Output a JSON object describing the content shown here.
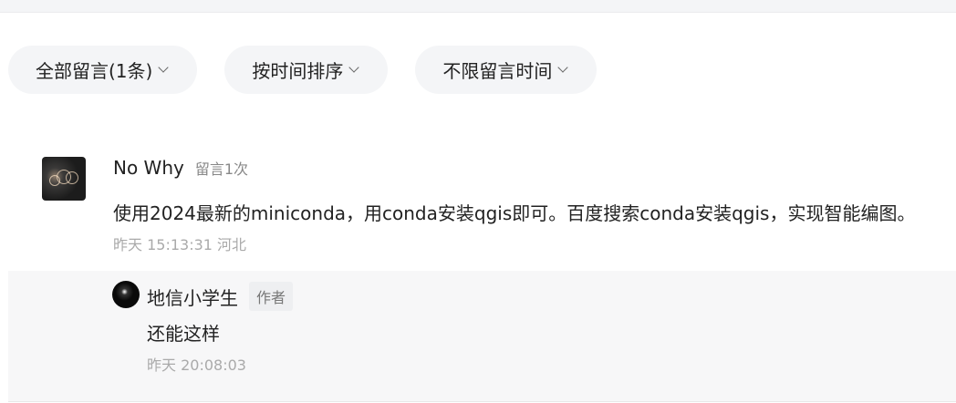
{
  "filters": [
    {
      "label": "全部留言(1条)"
    },
    {
      "label": "按时间排序"
    },
    {
      "label": "不限留言时间"
    }
  ],
  "comment": {
    "username": "No Why",
    "count_label": "留言1次",
    "text": "使用2024最新的miniconda，用conda安装qgis即可。百度搜索conda安装qgis，实现智能编图。",
    "meta": "昨天 15:13:31 河北"
  },
  "reply": {
    "username": "地信小学生",
    "badge": "作者",
    "text": "还能这样",
    "meta": "昨天 20:08:03"
  }
}
